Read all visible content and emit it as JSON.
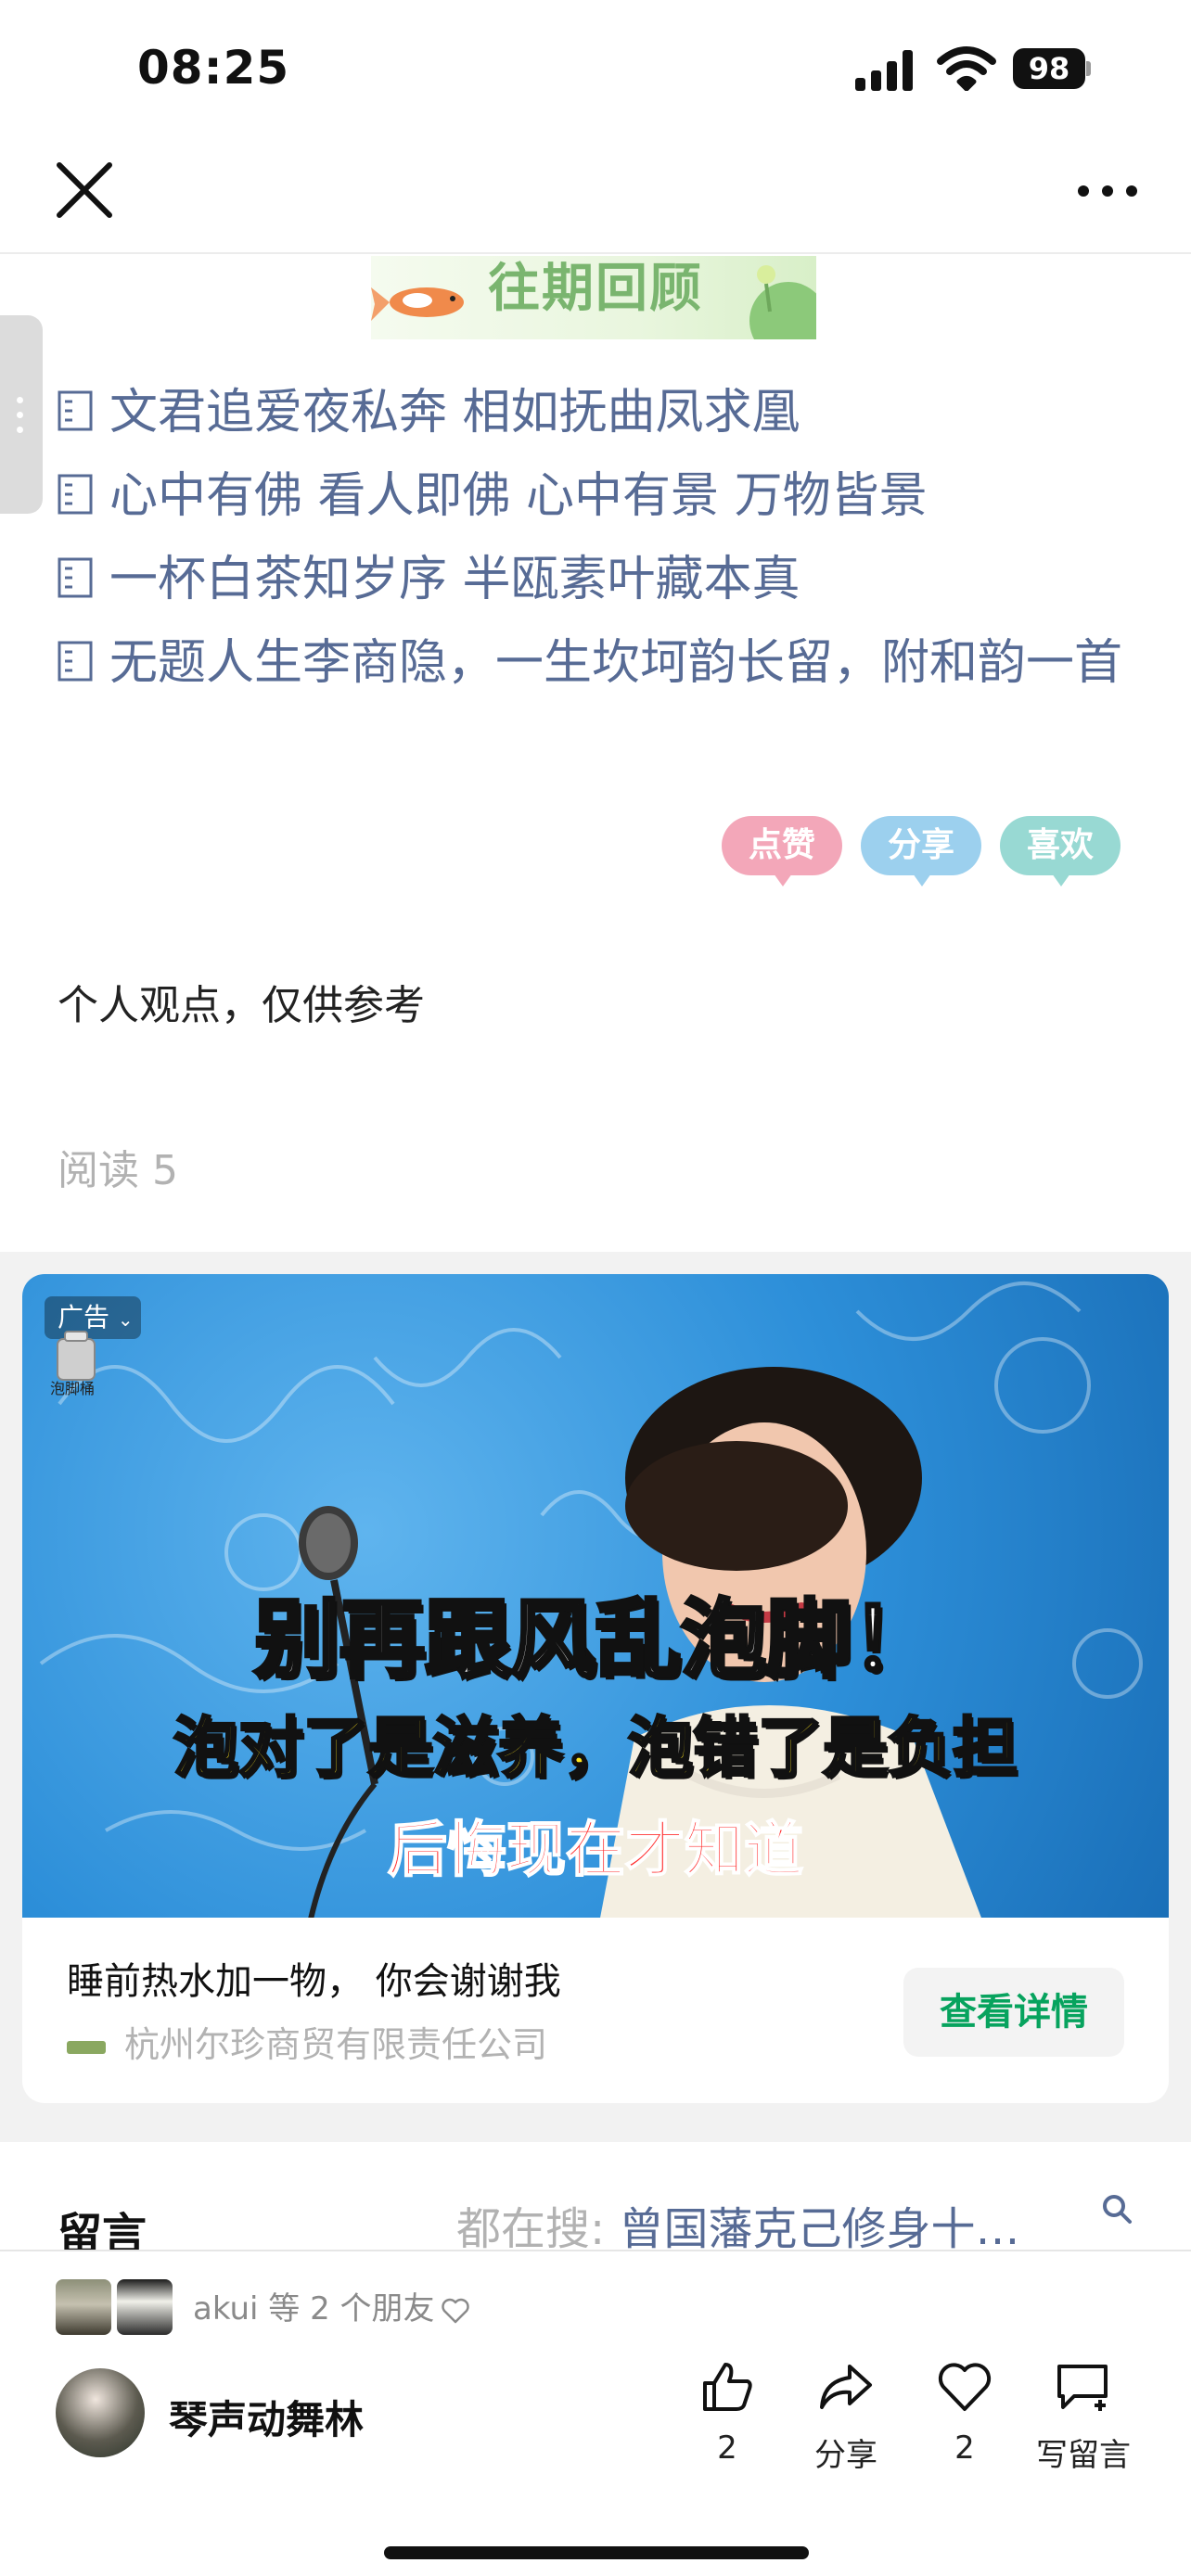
{
  "status_bar": {
    "time": "08:25",
    "battery": "98"
  },
  "banner": {
    "text": "往期回顾"
  },
  "article_links": [
    {
      "label": "文君追爱夜私奔 相如抚曲凤求凰"
    },
    {
      "label": "心中有佛 看人即佛  心中有景 万物皆景"
    },
    {
      "label": "一杯白茶知岁序 半瓯素叶藏本真"
    },
    {
      "label": "无题人生李商隐，一生坎坷韵长留，附和韵一首"
    }
  ],
  "stickers": {
    "like": "点赞",
    "share": "分享",
    "favorite": "喜欢"
  },
  "opinion_text": "个人观点，仅供参考",
  "read_count": "阅读 5",
  "ad": {
    "tag": "广告",
    "logo_text": "泡脚桶",
    "headline_1": "别再跟风乱泡脚！",
    "headline_2": "泡对了是滋养，泡错了是负担",
    "headline_3": "后悔现在才知道",
    "title": "睡前热水加一物， 你会谢谢我",
    "company": "杭州尔珍商贸有限责任公司",
    "button_label": "查看详情"
  },
  "comments": {
    "title": "留言",
    "search_prefix": "都在搜: ",
    "search_query": "曾国藩克己修身十…"
  },
  "bottom_bar": {
    "friends_text": "akui 等 2 个朋友",
    "author_name": "琴声动舞林",
    "like_count": "2",
    "share_label": "分享",
    "favorite_count": "2",
    "comment_label": "写留言"
  },
  "colors": {
    "link": "#576b95",
    "ad_button_text": "#07a35e",
    "muted": "#b2b2b2"
  }
}
